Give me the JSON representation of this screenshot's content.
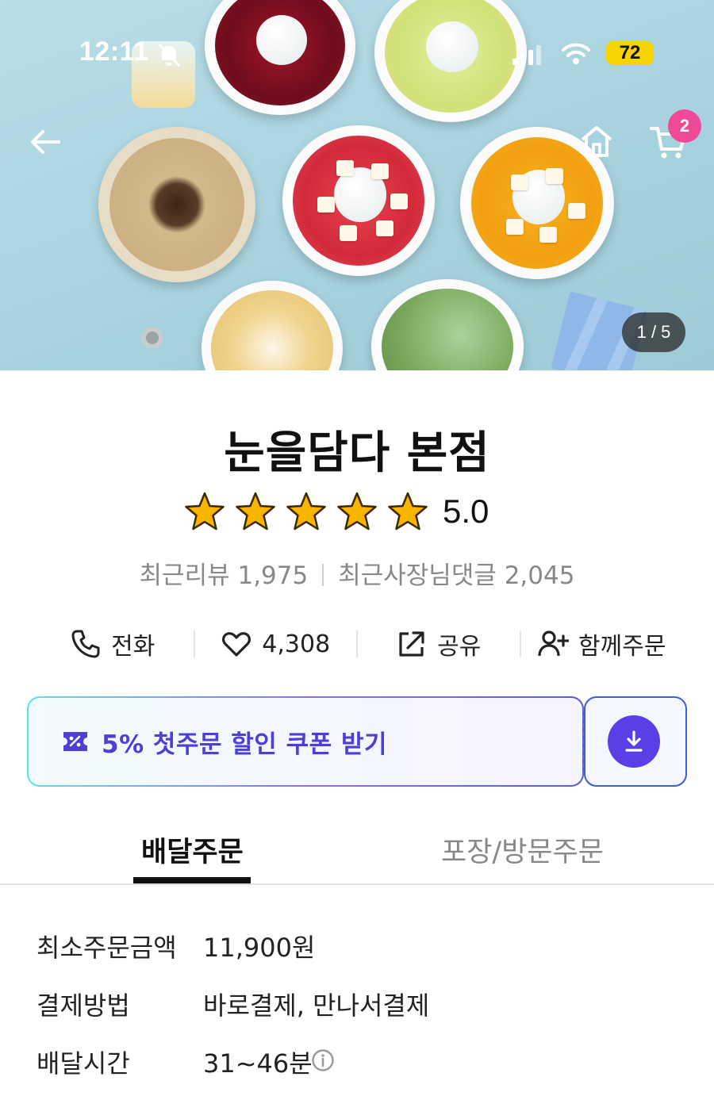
{
  "status_bar": {
    "time": "12:11",
    "battery": "72"
  },
  "hero": {
    "photo_counter": "1 / 5",
    "cart_count": "2"
  },
  "store": {
    "name": "눈을담다 본점",
    "rating": "5.0",
    "star_count": 5
  },
  "reviews": {
    "recent_reviews": "최근리뷰 1,975",
    "owner_replies": "최근사장님댓글 2,045"
  },
  "actions": {
    "call": "전화",
    "likes": "4,308",
    "share": "공유",
    "group_order": "함께주문"
  },
  "coupon": {
    "label": "5% 첫주문 할인 쿠폰 받기"
  },
  "tabs": [
    {
      "label": "배달주문",
      "active": true
    },
    {
      "label": "포장/방문주문",
      "active": false
    }
  ],
  "info": [
    {
      "label": "최소주문금액",
      "value": "11,900원"
    },
    {
      "label": "결제방법",
      "value": "바로결제, 만나서결제"
    },
    {
      "label": "배달시간",
      "value": "31~46분"
    }
  ],
  "colors": {
    "accent": "#5b3ee6",
    "badge": "#f04a97",
    "star": "#f7b500",
    "battery": "#f5d400"
  }
}
